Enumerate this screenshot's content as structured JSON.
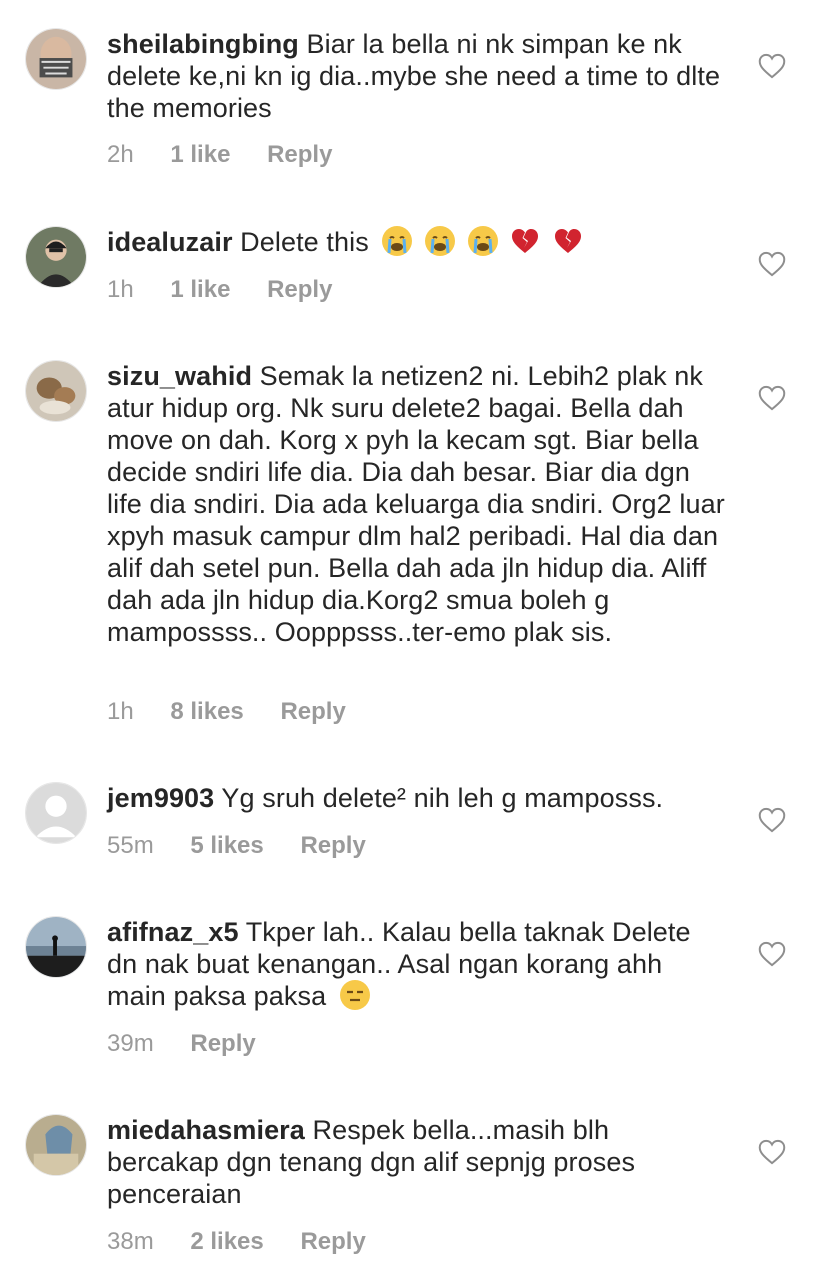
{
  "comments": [
    {
      "username": "sheilabingbing",
      "text": "Biar la bella ni nk simpan ke nk delete ke,ni kn ig dia..mybe she need a time to dlte the memories",
      "time": "2h",
      "likes": "1 like",
      "reply": "Reply"
    },
    {
      "username": "idealuzair",
      "text": "Delete this",
      "emojis": [
        "crying-face",
        "crying-face",
        "crying-face",
        "broken-heart",
        "broken-heart"
      ],
      "time": "1h",
      "likes": "1 like",
      "reply": "Reply"
    },
    {
      "username": "sizu_wahid",
      "text": "Semak la netizen2 ni. Lebih2 plak nk atur hidup org. Nk suru delete2 bagai. Bella dah move on dah. Korg x pyh la kecam sgt. Biar bella decide sndiri life dia. Dia dah besar. Biar dia dgn life dia sndiri. Dia ada keluarga dia sndiri. Org2 luar xpyh masuk campur dlm hal2 peribadi. Hal dia dan alif dah setel pun. Bella dah ada jln hidup dia. Aliff dah ada jln hidup dia.Korg2 smua boleh g mampossss.. Oopppsss..ter-emo plak sis.",
      "time": "1h",
      "likes": "8 likes",
      "reply": "Reply"
    },
    {
      "username": "jem9903",
      "text": "Yg sruh delete² nih leh g mamposss.",
      "time": "55m",
      "likes": "5 likes",
      "reply": "Reply"
    },
    {
      "username": "afifnaz_x5",
      "text": "Tkper lah.. Kalau bella taknak Delete dn nak buat kenangan.. Asal ngan korang ahh main paksa paksa",
      "emojis": [
        "expressionless-face"
      ],
      "time": "39m",
      "reply": "Reply"
    },
    {
      "username": "miedahasmiera",
      "text": "Respek bella...masih blh bercakap dgn tenang dgn alif sepnjg proses penceraian",
      "time": "38m",
      "likes": "2 likes",
      "reply": "Reply"
    }
  ],
  "icons": {
    "like": "heart-outline-icon"
  },
  "colors": {
    "text": "#262626",
    "meta": "#9a9a9a",
    "heart": "#8e8e8e"
  }
}
